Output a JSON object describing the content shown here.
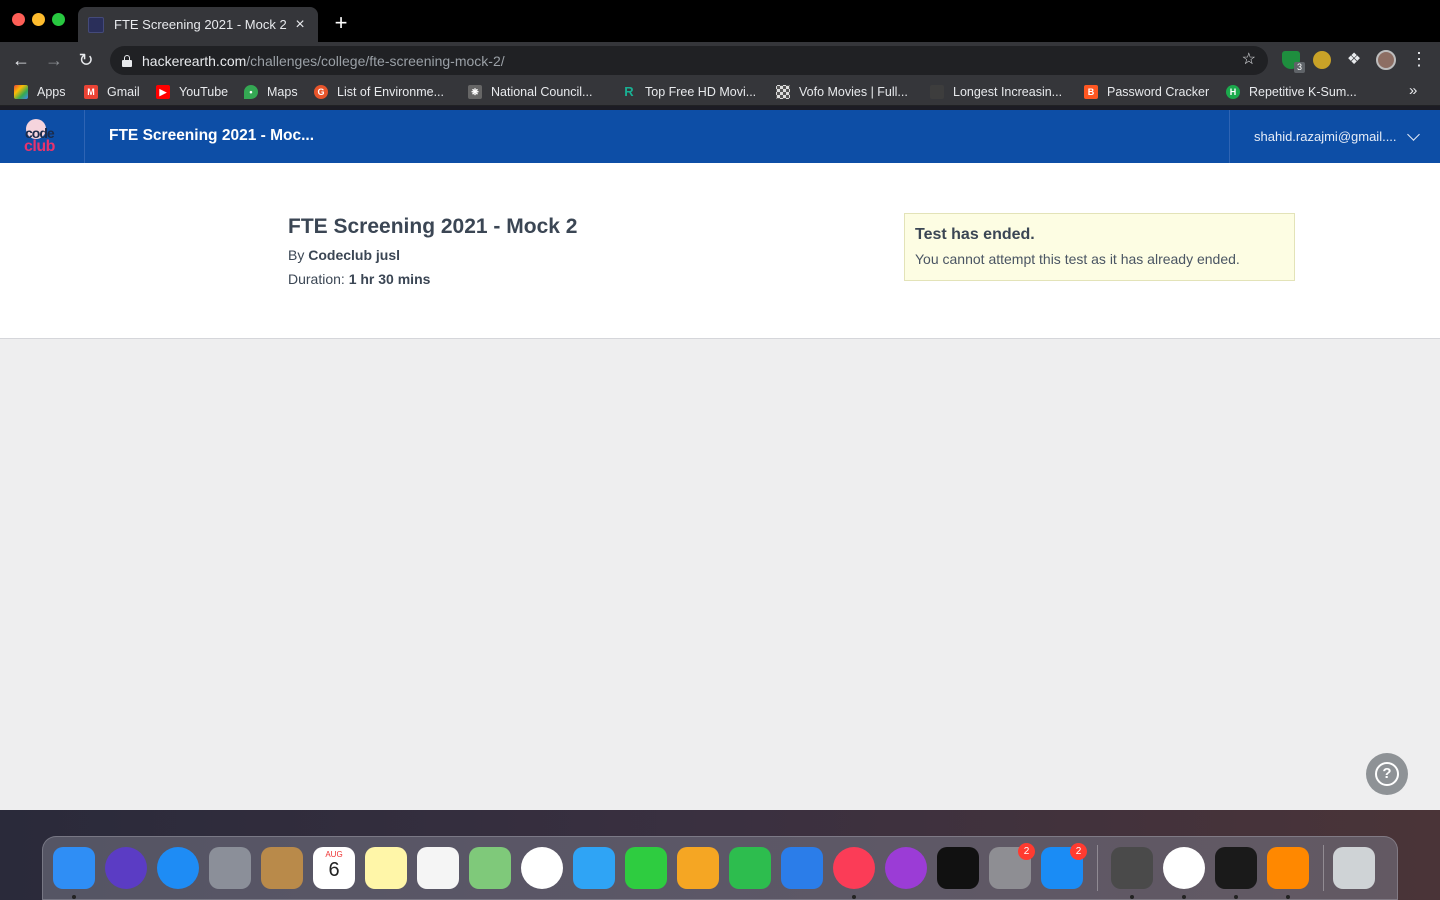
{
  "browser": {
    "tab_title": "FTE Screening 2021 - Mock 2",
    "tab_close": "×",
    "new_tab": "+",
    "url_host": "hackerearth.com",
    "url_path": "/challenges/college/fte-screening-mock-2/",
    "extension_badge": "3",
    "bookmarks": [
      {
        "label": "Apps",
        "icon": "apps-grid-icon",
        "color": "#4285f4"
      },
      {
        "label": "Gmail",
        "icon": "gmail-icon",
        "color": "#ea4335"
      },
      {
        "label": "YouTube",
        "icon": "youtube-icon",
        "color": "#ff0000"
      },
      {
        "label": "Maps",
        "icon": "maps-pin-icon",
        "color": "#34a853"
      },
      {
        "label": "List of Environme...",
        "icon": "geeks-icon",
        "color": "#e8552b"
      },
      {
        "label": "National Council...",
        "icon": "emblem-icon",
        "color": "#888888"
      },
      {
        "label": "Top Free HD Movi...",
        "icon": "r-logo-icon",
        "color": "#19b093"
      },
      {
        "label": "Vofo Movies | Full...",
        "icon": "checker-icon",
        "color": "#777777"
      },
      {
        "label": "Longest Increasin...",
        "icon": "faded-icon",
        "color": "#4a4a4a"
      },
      {
        "label": "Password Cracker",
        "icon": "blogger-icon",
        "color": "#ff5722"
      },
      {
        "label": "Repetitive K-Sum...",
        "icon": "hackerrank-icon",
        "color": "#1ba94c"
      }
    ]
  },
  "site": {
    "title": "FTE Screening 2021 - Moc...",
    "user_email": "shahid.razajmi@gmail....",
    "logo_code": "code",
    "logo_club": "club"
  },
  "challenge": {
    "title": "FTE Screening 2021 - Mock 2",
    "by_label": "By",
    "by_value": "Codeclub jusl",
    "duration_label": "Duration:",
    "duration_value": "1 hr 30 mins"
  },
  "notice": {
    "title": "Test has ended.",
    "text": "You cannot attempt this test as it has already ended."
  },
  "help_label": "?",
  "dock": {
    "calendar_month": "AUG",
    "calendar_day": "6",
    "apps": [
      {
        "name": "finder",
        "color": "#2f8ef5",
        "running": true
      },
      {
        "name": "siri",
        "color": "#5b3cc4",
        "running": false
      },
      {
        "name": "safari",
        "color": "#1e8cf5",
        "running": false
      },
      {
        "name": "launchpad",
        "color": "#8b8f99",
        "running": false
      },
      {
        "name": "contacts",
        "color": "#b98a4a",
        "running": false
      },
      {
        "name": "calendar",
        "color": "#ffffff",
        "running": false
      },
      {
        "name": "notes",
        "color": "#fff6a8",
        "running": false
      },
      {
        "name": "reminders",
        "color": "#f5f5f5",
        "running": false
      },
      {
        "name": "maps",
        "color": "#7fc97a",
        "running": false
      },
      {
        "name": "photos",
        "color": "#ffffff",
        "running": false
      },
      {
        "name": "messages",
        "color": "#2fa4f5",
        "running": false
      },
      {
        "name": "facetime",
        "color": "#2ecc40",
        "running": false
      },
      {
        "name": "pages",
        "color": "#f5a623",
        "running": false
      },
      {
        "name": "numbers",
        "color": "#2dbd4e",
        "running": false
      },
      {
        "name": "keynote",
        "color": "#2b7de9",
        "running": false
      },
      {
        "name": "music",
        "color": "#fb3c57",
        "running": true
      },
      {
        "name": "podcasts",
        "color": "#9b3cd6",
        "running": false
      },
      {
        "name": "tv",
        "color": "#111111",
        "running": false
      },
      {
        "name": "system-preferences",
        "color": "#8e8e93",
        "running": false,
        "badge": "2"
      },
      {
        "name": "app-store",
        "color": "#1a8cf5",
        "running": false,
        "badge": "2"
      },
      {
        "name": "sublime-text",
        "color": "#4a4a4a",
        "running": true
      },
      {
        "name": "chrome",
        "color": "#ffffff",
        "running": true
      },
      {
        "name": "terminal",
        "color": "#1a1a1a",
        "running": true
      },
      {
        "name": "vlc",
        "color": "#ff8800",
        "running": true
      },
      {
        "name": "trash",
        "color": "#cfd3d6",
        "running": false
      }
    ]
  }
}
